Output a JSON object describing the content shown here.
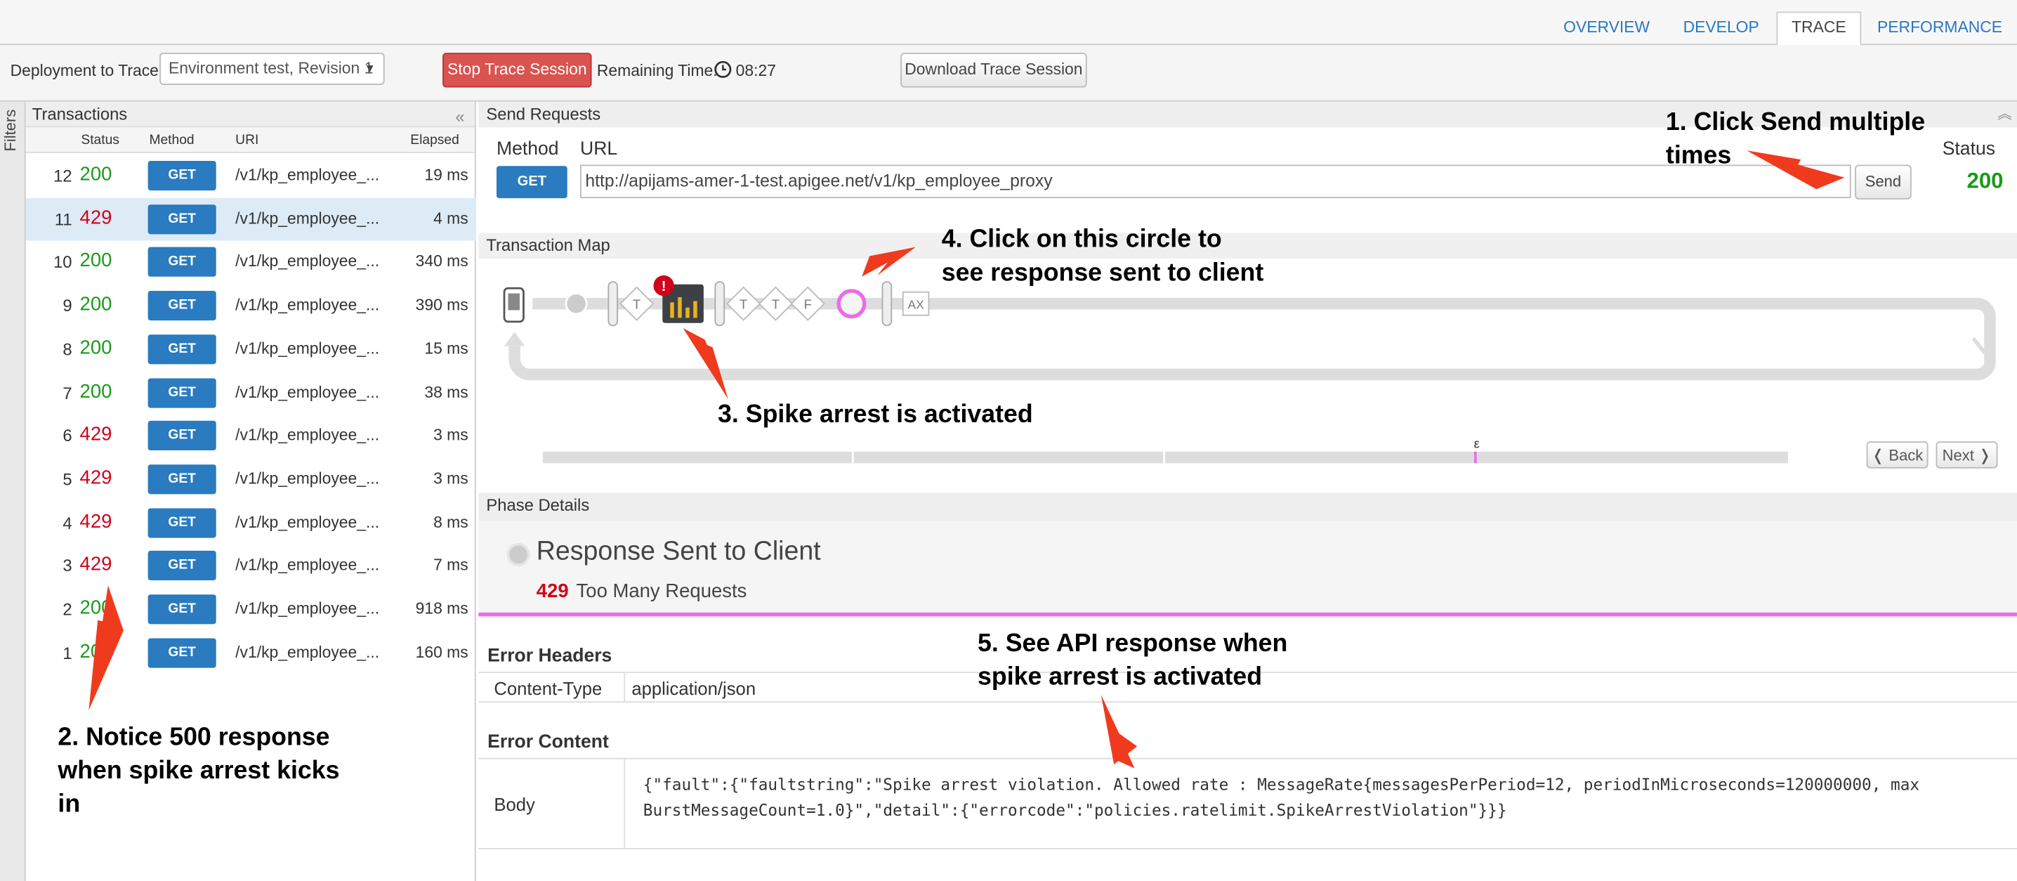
{
  "nav": {
    "tabs": [
      "OVERVIEW",
      "DEVELOP",
      "TRACE",
      "PERFORMANCE"
    ],
    "active": "TRACE"
  },
  "toolbar": {
    "deploy_label": "Deployment to Trace",
    "deploy_value": "Environment test, Revision 1",
    "stop_label": "Stop Trace Session",
    "remaining_label": "Remaining Time:",
    "remaining_value": "08:27",
    "download_label": "Download Trace Session"
  },
  "filters_label": "Filters",
  "transactions": {
    "title": "Transactions",
    "columns": [
      "Status",
      "Method",
      "URI",
      "Elapsed"
    ],
    "rows": [
      {
        "num": "12",
        "status": "200",
        "method": "GET",
        "uri": "/v1/kp_employee_...",
        "elapsed": "19 ms"
      },
      {
        "num": "11",
        "status": "429",
        "method": "GET",
        "uri": "/v1/kp_employee_...",
        "elapsed": "4 ms"
      },
      {
        "num": "10",
        "status": "200",
        "method": "GET",
        "uri": "/v1/kp_employee_...",
        "elapsed": "340 ms"
      },
      {
        "num": "9",
        "status": "200",
        "method": "GET",
        "uri": "/v1/kp_employee_...",
        "elapsed": "390 ms"
      },
      {
        "num": "8",
        "status": "200",
        "method": "GET",
        "uri": "/v1/kp_employee_...",
        "elapsed": "15 ms"
      },
      {
        "num": "7",
        "status": "200",
        "method": "GET",
        "uri": "/v1/kp_employee_...",
        "elapsed": "38 ms"
      },
      {
        "num": "6",
        "status": "429",
        "method": "GET",
        "uri": "/v1/kp_employee_...",
        "elapsed": "3 ms"
      },
      {
        "num": "5",
        "status": "429",
        "method": "GET",
        "uri": "/v1/kp_employee_...",
        "elapsed": "3 ms"
      },
      {
        "num": "4",
        "status": "429",
        "method": "GET",
        "uri": "/v1/kp_employee_...",
        "elapsed": "8 ms"
      },
      {
        "num": "3",
        "status": "429",
        "method": "GET",
        "uri": "/v1/kp_employee_...",
        "elapsed": "7 ms"
      },
      {
        "num": "2",
        "status": "200",
        "method": "GET",
        "uri": "/v1/kp_employee_...",
        "elapsed": "918 ms"
      },
      {
        "num": "1",
        "status": "200",
        "method": "GET",
        "uri": "/v1/kp_employee_...",
        "elapsed": "160 ms"
      }
    ]
  },
  "send": {
    "title": "Send Requests",
    "method_label": "Method",
    "url_label": "URL",
    "method": "GET",
    "url": "http://apijams-amer-1-test.apigee.net/v1/kp_employee_proxy",
    "send_label": "Send",
    "status_label": "Status",
    "status_value": "200"
  },
  "map": {
    "title": "Transaction Map",
    "nodes": [
      "T",
      "T",
      "T",
      "F",
      "AX"
    ],
    "marker": "ε",
    "back_label": "Back",
    "next_label": "Next"
  },
  "phase": {
    "title": "Phase Details",
    "name": "Response Sent to Client",
    "code": "429",
    "text": "Too Many Requests"
  },
  "error_headers": {
    "title": "Error Headers",
    "key": "Content-Type",
    "value": "application/json"
  },
  "error_content": {
    "title": "Error Content",
    "key": "Body",
    "line1": "{\"fault\":{\"faultstring\":\"Spike arrest violation. Allowed rate : MessageRate{messagesPerPeriod=12, periodInMicroseconds=120000000, max",
    "line2": "BurstMessageCount=1.0}\",\"detail\":{\"errorcode\":\"policies.ratelimit.SpikeArrestViolation\"}}}"
  },
  "annotations": {
    "a1": "1. Click Send multiple\ntimes",
    "a2": "2. Notice 500 response\nwhen spike arrest kicks\nin",
    "a3": "3. Spike arrest is activated",
    "a4": "4. Click on this circle to\nsee response sent to client",
    "a5": "5. See API response when\nspike arrest is activated"
  },
  "colors": {
    "accent": "#2a7bbf",
    "ok": "#1a9a1a",
    "error": "#d0021b",
    "stop": "#d9534f",
    "highlight": "#e86ee8",
    "arrow": "#f03a1e"
  }
}
